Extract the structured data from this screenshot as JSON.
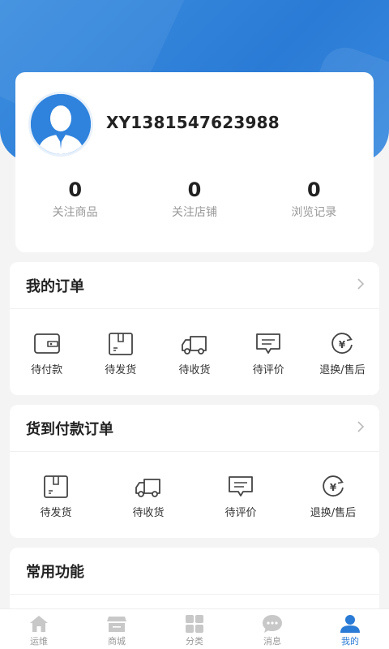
{
  "profile": {
    "username": "XY1381547623988",
    "stats": [
      {
        "value": "0",
        "label": "关注商品"
      },
      {
        "value": "0",
        "label": "关注店铺"
      },
      {
        "value": "0",
        "label": "浏览记录"
      }
    ]
  },
  "orders": {
    "title": "我的订单",
    "items": [
      "待付款",
      "待发货",
      "待收货",
      "待评价",
      "退换/售后"
    ]
  },
  "cod_orders": {
    "title": "货到付款订单",
    "items": [
      "待发货",
      "待收货",
      "待评价",
      "退换/售后"
    ]
  },
  "common": {
    "title": "常用功能"
  },
  "tabbar": {
    "items": [
      {
        "label": "运维",
        "icon": "home-icon"
      },
      {
        "label": "商城",
        "icon": "store-icon"
      },
      {
        "label": "分类",
        "icon": "category-icon"
      },
      {
        "label": "消息",
        "icon": "message-icon"
      },
      {
        "label": "我的",
        "icon": "user-icon"
      }
    ],
    "active_index": 4
  },
  "colors": {
    "accent": "#2a7bd5",
    "inactive": "#c8c8c8"
  }
}
